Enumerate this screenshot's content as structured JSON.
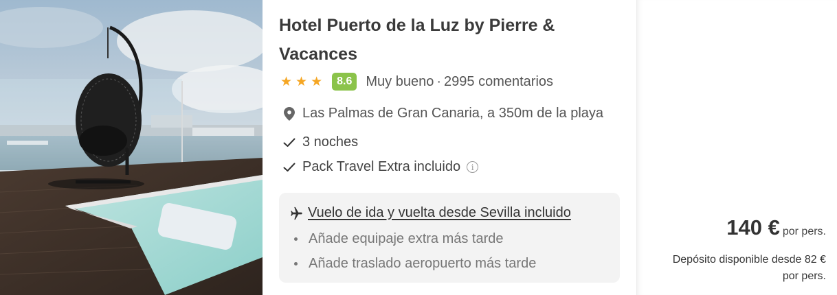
{
  "hotel": {
    "name": "Hotel Puerto de la Luz by Pierre & Vacances",
    "stars": 3,
    "score": "8.6",
    "rating_label": "Muy bueno",
    "separator": "·",
    "reviews": "2995 comentarios",
    "location": "Las Palmas de Gran Canaria, a 350m de la playa",
    "photo_alt": "Terraza con columpio y piscina frente al puerto"
  },
  "features": {
    "nights": "3 noches",
    "pack": "Pack Travel Extra incluido",
    "info_glyph": "i"
  },
  "flight": {
    "label": "Vuelo de ida y vuelta desde Sevilla incluido",
    "extras": [
      "Añade equipaje extra más tarde",
      "Añade traslado aeropuerto más tarde"
    ]
  },
  "pricing": {
    "price": "140 €",
    "per_person": "por pers.",
    "deposit_line1": "Depósito disponible desde 82 €",
    "deposit_line2": "por pers."
  },
  "colors": {
    "star": "#f5a623",
    "score_badge": "#8bc34a",
    "flight_box": "#f3f3f3"
  },
  "icons": [
    "star-icon",
    "location-pin-icon",
    "check-icon",
    "info-icon",
    "plane-icon"
  ]
}
